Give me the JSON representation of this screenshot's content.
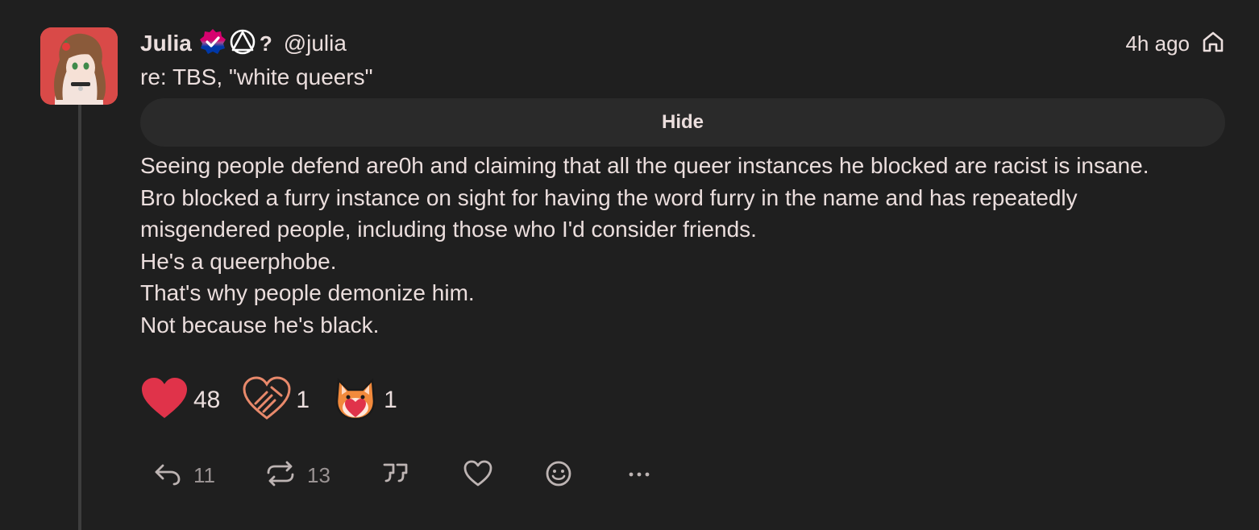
{
  "colors": {
    "background": "#1f1f1f",
    "text": "#ebdedd",
    "muted": "#9a9393",
    "hide_button_bg": "#2a2a2a",
    "heart": "#e0334a",
    "avatar_bg": "#d94a48"
  },
  "note": {
    "author_name": "Julia",
    "author_badge_suffix": "?",
    "author_handle": "@julia",
    "time": "4h ago",
    "visibility_icon": "home-icon",
    "cw": "re: TBS, \"white queers\"",
    "hide_label": "Hide",
    "body_lines": [
      "Seeing people defend are0h and claiming that all the queer instances he blocked are racist is insane.",
      "Bro blocked a furry instance on sight for having the word furry in the name and has repeatedly misgendered people, including those who I'd consider friends.",
      "He's a queerphobe.",
      "That's why people demonize him.",
      "Not because he's black."
    ]
  },
  "reactions": [
    {
      "icon": "red-heart-emoji",
      "count": "48"
    },
    {
      "icon": "handshake-heart-emoji",
      "count": "1"
    },
    {
      "icon": "fox-heart-emoji",
      "count": "1"
    }
  ],
  "footer": {
    "reply_count": "11",
    "renote_count": "13",
    "icons": [
      "reply-icon",
      "renote-icon",
      "quote-icon",
      "heart-outline-icon",
      "emoji-reaction-icon",
      "more-icon"
    ]
  }
}
